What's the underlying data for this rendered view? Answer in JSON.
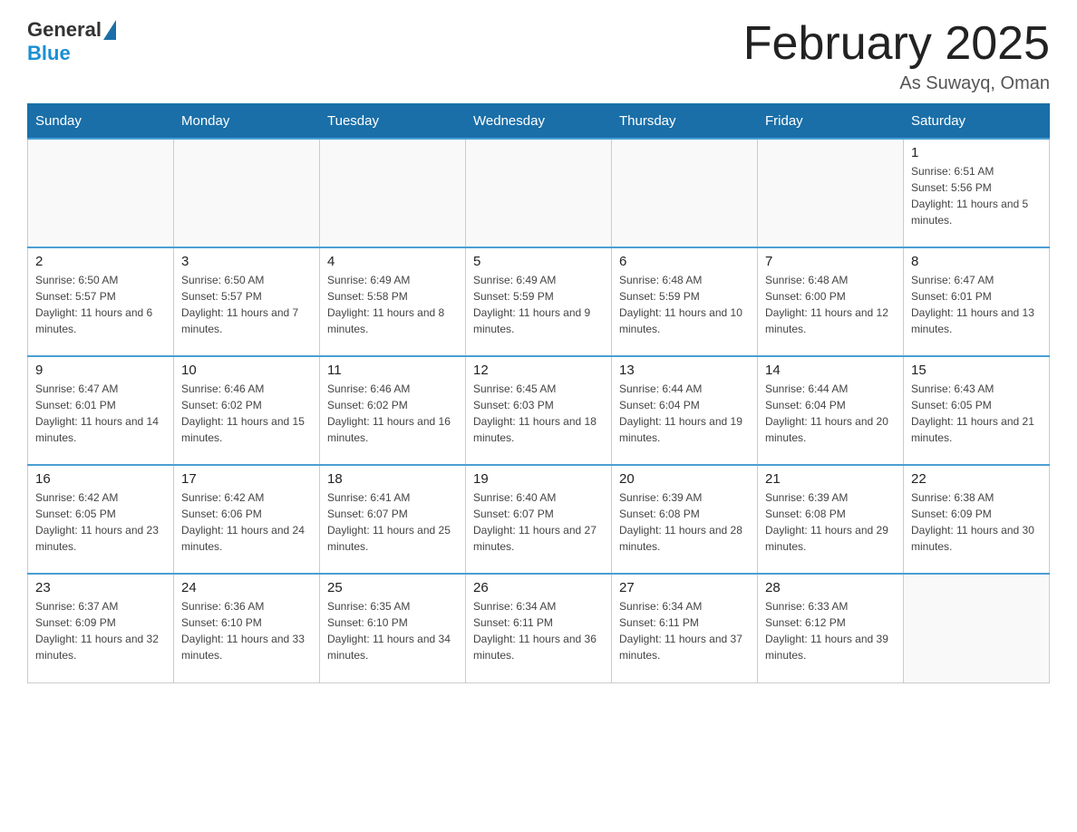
{
  "logo": {
    "general": "General",
    "blue": "Blue"
  },
  "header": {
    "title": "February 2025",
    "location": "As Suwayq, Oman"
  },
  "weekdays": [
    "Sunday",
    "Monday",
    "Tuesday",
    "Wednesday",
    "Thursday",
    "Friday",
    "Saturday"
  ],
  "weeks": [
    [
      {
        "day": "",
        "sunrise": "",
        "sunset": "",
        "daylight": ""
      },
      {
        "day": "",
        "sunrise": "",
        "sunset": "",
        "daylight": ""
      },
      {
        "day": "",
        "sunrise": "",
        "sunset": "",
        "daylight": ""
      },
      {
        "day": "",
        "sunrise": "",
        "sunset": "",
        "daylight": ""
      },
      {
        "day": "",
        "sunrise": "",
        "sunset": "",
        "daylight": ""
      },
      {
        "day": "",
        "sunrise": "",
        "sunset": "",
        "daylight": ""
      },
      {
        "day": "1",
        "sunrise": "Sunrise: 6:51 AM",
        "sunset": "Sunset: 5:56 PM",
        "daylight": "Daylight: 11 hours and 5 minutes."
      }
    ],
    [
      {
        "day": "2",
        "sunrise": "Sunrise: 6:50 AM",
        "sunset": "Sunset: 5:57 PM",
        "daylight": "Daylight: 11 hours and 6 minutes."
      },
      {
        "day": "3",
        "sunrise": "Sunrise: 6:50 AM",
        "sunset": "Sunset: 5:57 PM",
        "daylight": "Daylight: 11 hours and 7 minutes."
      },
      {
        "day": "4",
        "sunrise": "Sunrise: 6:49 AM",
        "sunset": "Sunset: 5:58 PM",
        "daylight": "Daylight: 11 hours and 8 minutes."
      },
      {
        "day": "5",
        "sunrise": "Sunrise: 6:49 AM",
        "sunset": "Sunset: 5:59 PM",
        "daylight": "Daylight: 11 hours and 9 minutes."
      },
      {
        "day": "6",
        "sunrise": "Sunrise: 6:48 AM",
        "sunset": "Sunset: 5:59 PM",
        "daylight": "Daylight: 11 hours and 10 minutes."
      },
      {
        "day": "7",
        "sunrise": "Sunrise: 6:48 AM",
        "sunset": "Sunset: 6:00 PM",
        "daylight": "Daylight: 11 hours and 12 minutes."
      },
      {
        "day": "8",
        "sunrise": "Sunrise: 6:47 AM",
        "sunset": "Sunset: 6:01 PM",
        "daylight": "Daylight: 11 hours and 13 minutes."
      }
    ],
    [
      {
        "day": "9",
        "sunrise": "Sunrise: 6:47 AM",
        "sunset": "Sunset: 6:01 PM",
        "daylight": "Daylight: 11 hours and 14 minutes."
      },
      {
        "day": "10",
        "sunrise": "Sunrise: 6:46 AM",
        "sunset": "Sunset: 6:02 PM",
        "daylight": "Daylight: 11 hours and 15 minutes."
      },
      {
        "day": "11",
        "sunrise": "Sunrise: 6:46 AM",
        "sunset": "Sunset: 6:02 PM",
        "daylight": "Daylight: 11 hours and 16 minutes."
      },
      {
        "day": "12",
        "sunrise": "Sunrise: 6:45 AM",
        "sunset": "Sunset: 6:03 PM",
        "daylight": "Daylight: 11 hours and 18 minutes."
      },
      {
        "day": "13",
        "sunrise": "Sunrise: 6:44 AM",
        "sunset": "Sunset: 6:04 PM",
        "daylight": "Daylight: 11 hours and 19 minutes."
      },
      {
        "day": "14",
        "sunrise": "Sunrise: 6:44 AM",
        "sunset": "Sunset: 6:04 PM",
        "daylight": "Daylight: 11 hours and 20 minutes."
      },
      {
        "day": "15",
        "sunrise": "Sunrise: 6:43 AM",
        "sunset": "Sunset: 6:05 PM",
        "daylight": "Daylight: 11 hours and 21 minutes."
      }
    ],
    [
      {
        "day": "16",
        "sunrise": "Sunrise: 6:42 AM",
        "sunset": "Sunset: 6:05 PM",
        "daylight": "Daylight: 11 hours and 23 minutes."
      },
      {
        "day": "17",
        "sunrise": "Sunrise: 6:42 AM",
        "sunset": "Sunset: 6:06 PM",
        "daylight": "Daylight: 11 hours and 24 minutes."
      },
      {
        "day": "18",
        "sunrise": "Sunrise: 6:41 AM",
        "sunset": "Sunset: 6:07 PM",
        "daylight": "Daylight: 11 hours and 25 minutes."
      },
      {
        "day": "19",
        "sunrise": "Sunrise: 6:40 AM",
        "sunset": "Sunset: 6:07 PM",
        "daylight": "Daylight: 11 hours and 27 minutes."
      },
      {
        "day": "20",
        "sunrise": "Sunrise: 6:39 AM",
        "sunset": "Sunset: 6:08 PM",
        "daylight": "Daylight: 11 hours and 28 minutes."
      },
      {
        "day": "21",
        "sunrise": "Sunrise: 6:39 AM",
        "sunset": "Sunset: 6:08 PM",
        "daylight": "Daylight: 11 hours and 29 minutes."
      },
      {
        "day": "22",
        "sunrise": "Sunrise: 6:38 AM",
        "sunset": "Sunset: 6:09 PM",
        "daylight": "Daylight: 11 hours and 30 minutes."
      }
    ],
    [
      {
        "day": "23",
        "sunrise": "Sunrise: 6:37 AM",
        "sunset": "Sunset: 6:09 PM",
        "daylight": "Daylight: 11 hours and 32 minutes."
      },
      {
        "day": "24",
        "sunrise": "Sunrise: 6:36 AM",
        "sunset": "Sunset: 6:10 PM",
        "daylight": "Daylight: 11 hours and 33 minutes."
      },
      {
        "day": "25",
        "sunrise": "Sunrise: 6:35 AM",
        "sunset": "Sunset: 6:10 PM",
        "daylight": "Daylight: 11 hours and 34 minutes."
      },
      {
        "day": "26",
        "sunrise": "Sunrise: 6:34 AM",
        "sunset": "Sunset: 6:11 PM",
        "daylight": "Daylight: 11 hours and 36 minutes."
      },
      {
        "day": "27",
        "sunrise": "Sunrise: 6:34 AM",
        "sunset": "Sunset: 6:11 PM",
        "daylight": "Daylight: 11 hours and 37 minutes."
      },
      {
        "day": "28",
        "sunrise": "Sunrise: 6:33 AM",
        "sunset": "Sunset: 6:12 PM",
        "daylight": "Daylight: 11 hours and 39 minutes."
      },
      {
        "day": "",
        "sunrise": "",
        "sunset": "",
        "daylight": ""
      }
    ]
  ]
}
